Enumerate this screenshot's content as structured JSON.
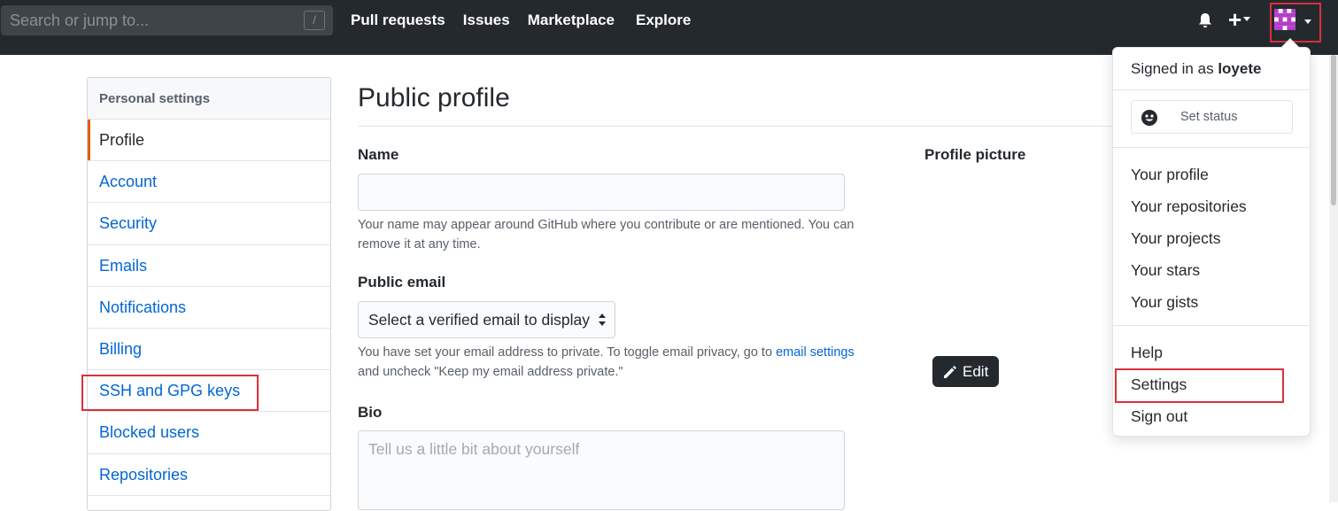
{
  "header": {
    "search_placeholder": "Search or jump to...",
    "search_shortcut": "/",
    "nav": [
      "Pull requests",
      "Issues",
      "Marketplace",
      "Explore"
    ],
    "plus_label": "+"
  },
  "sidebar": {
    "heading": "Personal settings",
    "items": [
      {
        "label": "Profile",
        "active": true
      },
      {
        "label": "Account"
      },
      {
        "label": "Security"
      },
      {
        "label": "Emails"
      },
      {
        "label": "Notifications"
      },
      {
        "label": "Billing"
      },
      {
        "label": "SSH and GPG keys"
      },
      {
        "label": "Blocked users"
      },
      {
        "label": "Repositories"
      }
    ]
  },
  "main": {
    "title": "Public profile",
    "name_label": "Name",
    "name_value": "",
    "name_note": "Your name may appear around GitHub where you contribute or are mentioned. You can remove it at any time.",
    "email_label": "Public email",
    "email_select": "Select a verified email to display",
    "email_note_pre": "You have set your email address to private. To toggle email privacy, go to",
    "email_note_link": "email settings",
    "email_note_post": "and uncheck \"Keep my email address private.\"",
    "bio_label": "Bio",
    "bio_placeholder": "Tell us a little bit about yourself",
    "picture_label": "Profile picture",
    "edit_label": "Edit"
  },
  "dropdown": {
    "signed_in_prefix": "Signed in as",
    "username": "loyete",
    "set_status": "Set status",
    "items": [
      "Your profile",
      "Your repositories",
      "Your projects",
      "Your stars",
      "Your gists",
      "Help",
      "Settings",
      "Sign out"
    ]
  },
  "colors": {
    "header_bg": "#24292e",
    "link": "#0366d6",
    "highlight": "#d9303b",
    "active_bar": "#e36209",
    "avatar": "#b33fc9"
  }
}
